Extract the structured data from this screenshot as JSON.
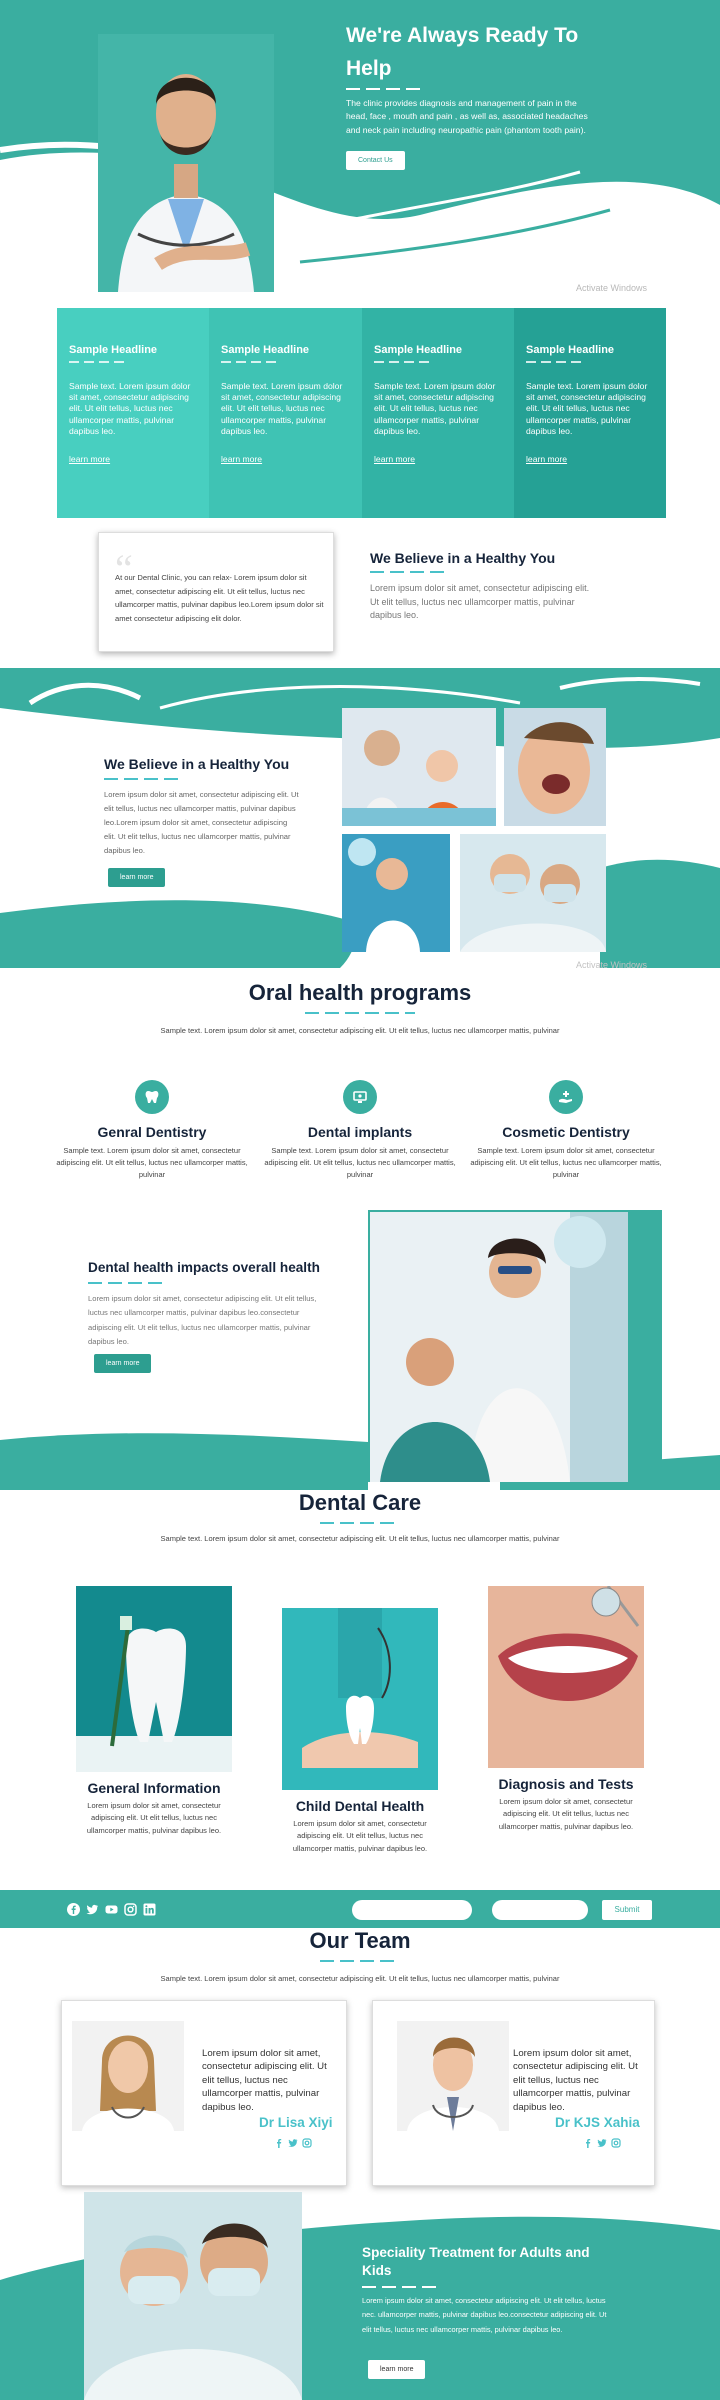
{
  "hero": {
    "title": "We're Always Ready To Help",
    "text": "The clinic provides diagnosis and management of pain in the head, face , mouth and pain , as well as, associated headaches and neck pain including neuropathic pain (phantom tooth pain).",
    "button": "Contact Us",
    "watermark": "Activate Windows"
  },
  "features": [
    {
      "title": "Sample Headline",
      "text": "Sample text. Lorem ipsum dolor sit amet, consectetur adipiscing elit. Ut elit tellus, luctus nec ullamcorper mattis, pulvinar dapibus leo.",
      "link": "learn more",
      "color": "#48cfc0"
    },
    {
      "title": "Sample Headline",
      "text": "Sample text. Lorem ipsum dolor sit amet, consectetur adipiscing elit. Ut elit tellus, luctus nec ullamcorper mattis, pulvinar dapibus leo.",
      "link": "learn more",
      "color": "#3fc3b4"
    },
    {
      "title": "Sample Headline",
      "text": "Sample text. Lorem ipsum dolor sit amet, consectetur adipiscing elit. Ut elit tellus, luctus nec ullamcorper mattis, pulvinar dapibus leo.",
      "link": "learn more",
      "color": "#32b3a5"
    },
    {
      "title": "Sample Headline",
      "text": "Sample text. Lorem ipsum dolor sit amet, consectetur adipiscing elit. Ut elit tellus, luctus nec ullamcorper mattis, pulvinar dapibus leo.",
      "link": "learn more",
      "color": "#25a195"
    }
  ],
  "quote": {
    "text": "At our Dental Clinic, you can relax- Lorem ipsum dolor sit amet, consectetur adipiscing elit. Ut elit tellus, luctus nec ullamcorper mattis, pulvinar dapibus leo.Lorem ipsum dolor sit amet consectetur adipiscing elit dolor."
  },
  "believe1": {
    "title": "We Believe in a Healthy You",
    "text": "Lorem ipsum dolor sit amet, consectetur adipiscing elit. Ut elit tellus, luctus nec ullamcorper mattis, pulvinar dapibus leo."
  },
  "believe2": {
    "title": "We Believe in a Healthy You",
    "text": "Lorem ipsum dolor sit amet, consectetur adipiscing elit. Ut elit tellus, luctus nec ullamcorper mattis, pulvinar dapibus leo.Lorem ipsum dolor sit amet, consectetur adipiscing elit. Ut elit tellus, luctus nec ullamcorper mattis, pulvinar dapibus leo.",
    "button": "learn more",
    "watermark": "Activate Windows"
  },
  "oral": {
    "title": "Oral health programs",
    "subtitle": "Sample text. Lorem ipsum dolor sit amet, consectetur adipiscing elit. Ut elit tellus, luctus nec ullamcorper mattis, pulvinar",
    "items": [
      {
        "title": "Genral Dentistry",
        "text": "Sample text. Lorem ipsum dolor sit amet, consectetur adipiscing elit. Ut elit tellus, luctus nec ullamcorper mattis, pulvinar",
        "icon": "tooth-icon"
      },
      {
        "title": "Dental implants",
        "text": "Sample text. Lorem ipsum dolor sit amet, consectetur adipiscing elit. Ut elit tellus, luctus nec ullamcorper mattis, pulvinar",
        "icon": "monitor-icon"
      },
      {
        "title": "Cosmetic Dentistry",
        "text": "Sample text. Lorem ipsum dolor sit amet, consectetur adipiscing elit. Ut elit tellus, luctus nec ullamcorper mattis, pulvinar",
        "icon": "hand-plus-icon"
      }
    ]
  },
  "impacts": {
    "title": "Dental health impacts overall health",
    "text": "Lorem ipsum dolor sit amet, consectetur adipiscing elit. Ut elit tellus, luctus nec ullamcorper mattis, pulvinar dapibus leo.consectetur adipiscing elit. Ut elit tellus, luctus nec ullamcorper mattis, pulvinar dapibus leo.",
    "button": "learn more"
  },
  "care": {
    "title": "Dental Care",
    "subtitle": "Sample text. Lorem ipsum dolor sit amet, consectetur adipiscing elit. Ut elit tellus, luctus nec ullamcorper mattis, pulvinar",
    "items": [
      {
        "title": "General Information",
        "text": "Lorem ipsum dolor sit amet, consectetur adipiscing elit. Ut elit tellus, luctus nec ullamcorper mattis, pulvinar dapibus leo."
      },
      {
        "title": "Child Dental Health",
        "text": "Lorem ipsum dolor sit amet, consectetur adipiscing elit. Ut elit tellus, luctus nec ullamcorper mattis, pulvinar dapibus leo."
      },
      {
        "title": "Diagnosis and Tests",
        "text": "Lorem ipsum dolor sit amet, consectetur adipiscing elit. Ut elit tellus, luctus nec ullamcorper mattis, pulvinar dapibus leo."
      }
    ]
  },
  "subscribe": {
    "name_placeholder": "",
    "email_placeholder": "",
    "button": "Submit",
    "social": [
      "facebook-icon",
      "twitter-icon",
      "youtube-icon",
      "instagram-icon",
      "linkedin-icon"
    ]
  },
  "team": {
    "title": "Our Team",
    "subtitle": "Sample text. Lorem ipsum dolor sit amet, consectetur adipiscing elit. Ut elit tellus, luctus nec ullamcorper mattis, pulvinar",
    "members": [
      {
        "name": "Dr Lisa Xiyi",
        "text": "Lorem ipsum dolor sit amet, consectetur adipiscing elit. Ut elit tellus, luctus nec ullamcorper mattis, pulvinar dapibus leo."
      },
      {
        "name": "Dr KJS Xahia",
        "text": "Lorem ipsum dolor sit amet, consectetur adipiscing elit. Ut elit tellus, luctus nec ullamcorper mattis, pulvinar dapibus leo."
      }
    ]
  },
  "speciality": {
    "title": "Speciality Treatment for Adults and Kids",
    "text": "Lorem ipsum dolor sit amet, consectetur adipiscing elit. Ut elit tellus, luctus nec. ullamcorper mattis, pulvinar dapibus leo.consectetur adipiscing elit. Ut elit tellus, luctus nec ullamcorper mattis, pulvinar dapibus leo.",
    "button": "learn more"
  },
  "colors": {
    "teal": "#3aaea0",
    "accent": "#49c1c9",
    "navy": "#16243a"
  }
}
